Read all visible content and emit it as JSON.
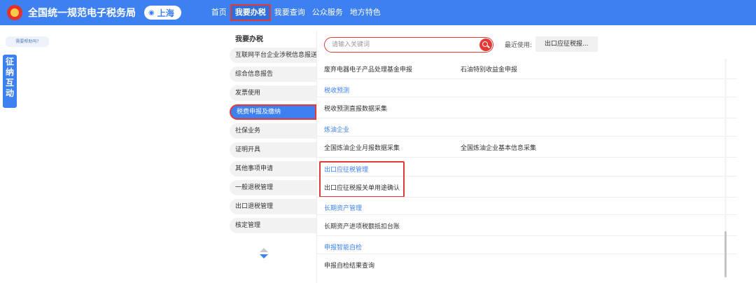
{
  "header": {
    "site_title": "全国统一规范电子税务局",
    "region": "上海",
    "nav": [
      "首页",
      "我要办税",
      "我要查询",
      "公众服务",
      "地方特色"
    ]
  },
  "left": {
    "help_label": "需要帮助吗?",
    "side_tab": [
      "征",
      "纳",
      "互",
      "动"
    ]
  },
  "categories": {
    "title": "我要办税",
    "items": [
      "互联网平台企业涉税信息报送",
      "综合信息报告",
      "发票使用",
      "税费申报及缴纳",
      "社保业务",
      "证明开具",
      "其他事项申请",
      "一般退税管理",
      "出口退税管理",
      "核定管理"
    ],
    "active_index": 3
  },
  "search": {
    "placeholder": "请输入关键词",
    "recent_label": "最近使用:",
    "recent_item": "出口应征税报..."
  },
  "content": {
    "partial_top": "",
    "row_waste_1": "废弃电器电子产品处理基金申报",
    "row_waste_2": "石油特别收益金申报",
    "sec_tax_forecast": "税收预测",
    "row_tax_forecast": "税收预测直报数据采集",
    "sec_refinery": "炼油企业",
    "row_refinery_1": "全国炼油企业月报数据采集",
    "row_refinery_2": "全国炼油企业基本信息采集",
    "sec_export": "出口应征税管理",
    "row_export": "出口应征税报关单用途确认",
    "sec_longterm": "长期资产管理",
    "row_longterm": "长期资产进项税额抵扣台账",
    "sec_selfcheck": "申报智能自检",
    "row_selfcheck": "申报自检结果查询"
  },
  "colors": {
    "primary": "#3d80f0",
    "highlight": "#e53935"
  }
}
